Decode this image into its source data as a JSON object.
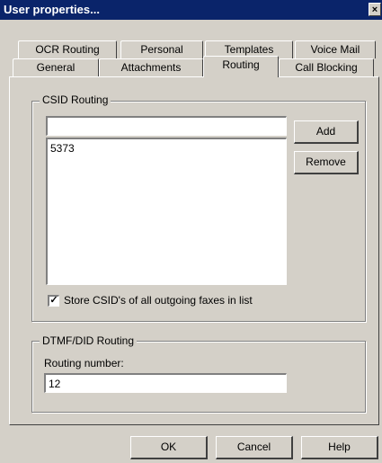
{
  "window": {
    "title": "User properties...",
    "close_glyph": "×"
  },
  "tabs": {
    "row1": [
      {
        "label": "OCR Routing"
      },
      {
        "label": "Personal"
      },
      {
        "label": "Templates"
      },
      {
        "label": "Voice Mail"
      }
    ],
    "row2": [
      {
        "label": "General"
      },
      {
        "label": "Attachments"
      },
      {
        "label": "Routing",
        "active": true
      },
      {
        "label": "Call Blocking"
      }
    ]
  },
  "csid": {
    "group_title": "CSID Routing",
    "input_value": "",
    "add_label": "Add",
    "remove_label": "Remove",
    "list_items": [
      "5373"
    ],
    "store_checkbox": {
      "checked": true,
      "check_glyph": "✓",
      "label": "Store CSID's of all outgoing faxes in list"
    }
  },
  "dtmf": {
    "group_title": "DTMF/DID Routing",
    "routing_label": "Routing number:",
    "routing_value": "12"
  },
  "footer": {
    "ok_label": "OK",
    "cancel_label": "Cancel",
    "help_label": "Help"
  }
}
